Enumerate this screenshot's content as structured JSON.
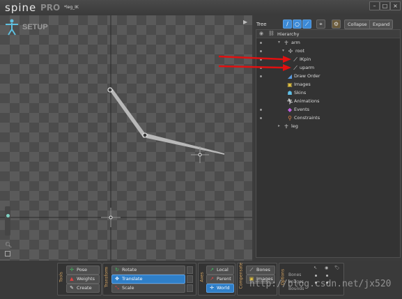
{
  "app": {
    "logo": "spine",
    "edition": "PRO",
    "project": "*leg_IK"
  },
  "window_controls": [
    "–",
    "□",
    "×"
  ],
  "viewport": {
    "mode_label": "SETUP"
  },
  "tree": {
    "title": "Tree",
    "collapse_label": "Collapse",
    "expand_label": "Expand",
    "column_header": "Hierarchy",
    "rows": [
      {
        "label": "arm",
        "icon": "skeleton-icon",
        "toggle": "▾"
      },
      {
        "label": "root",
        "icon": "bone-icon",
        "toggle": "▾"
      },
      {
        "label": "IKpin",
        "icon": "bone-icon"
      },
      {
        "label": "uparm",
        "icon": "bone-icon"
      },
      {
        "label": "Draw Order",
        "icon": "draw-order-icon"
      },
      {
        "label": "Images",
        "icon": "images-icon"
      },
      {
        "label": "Skins",
        "icon": "skins-icon"
      },
      {
        "label": "Animations",
        "icon": "animations-icon"
      },
      {
        "label": "Events",
        "icon": "events-icon"
      },
      {
        "label": "Constraints",
        "icon": "constraints-icon"
      },
      {
        "label": "leg",
        "icon": "skeleton-icon",
        "toggle": "▸"
      }
    ]
  },
  "toolbar": {
    "tools": {
      "label": "Tools",
      "pose": "Pose",
      "weights": "Weights",
      "create": "Create"
    },
    "transform": {
      "label": "Transform",
      "rotate": "Rotate",
      "translate": "Translate",
      "scale": "Scale"
    },
    "axes": {
      "label": "Axes",
      "local": "Local",
      "parent": "Parent",
      "world": "World"
    },
    "compensate": {
      "label": "Compensate",
      "bones": "Bones",
      "images": "Images"
    },
    "options": {
      "label": "Options",
      "bones": "Bones",
      "images": "Images",
      "bounds": "Bounds"
    }
  },
  "watermark": "http://blog.csdn.net/jx520",
  "colors": {
    "accent": "#2f7fc8",
    "annotation_arrow": "#e01010",
    "group_label": "#d0a060"
  }
}
